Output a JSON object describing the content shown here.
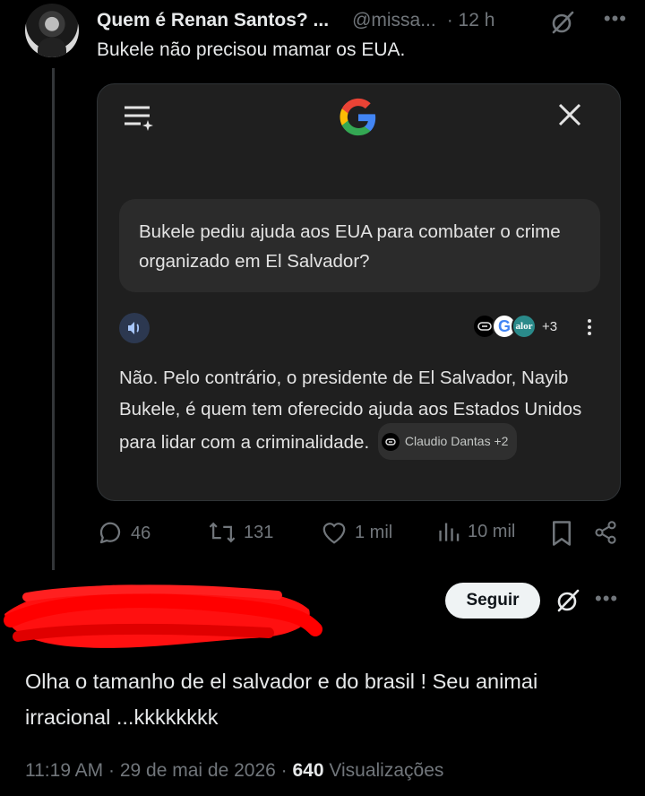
{
  "tweet": {
    "author_name": "Quem é Renan Santos? ...",
    "handle": "@missa...",
    "time": "· 12 h",
    "text": "Bukele não precisou mamar os EUA."
  },
  "card": {
    "question": "Bukele pediu ajuda aos EUA para combater o crime organizado em El Salvador?",
    "sources_extra": "+3",
    "answer": "Não. Pelo contrário, o presidente de El Salvador, Nayib Bukele, é quem tem oferecido ajuda aos Estados Unidos para lidar com a criminalidade.",
    "chip_label": "Claudio Dantas +2",
    "source_g": "G",
    "source_valor": "alor"
  },
  "actions": {
    "replies": "46",
    "reposts": "131",
    "likes": "1 mil",
    "views": "10 mil"
  },
  "reply": {
    "follow_label": "Seguir",
    "text": "Olha o tamanho de el salvador e do brasil ! Seu animai irracional ...kkkkkkkk",
    "time": "11:19 AM · 29 de mai de 2026 · ",
    "views_count": "640",
    "views_label": " Visualizações"
  },
  "colors": {
    "background": "#000000",
    "muted": "#71767b",
    "card_bg": "#1f1f1f",
    "redaction": "#ff0000"
  }
}
